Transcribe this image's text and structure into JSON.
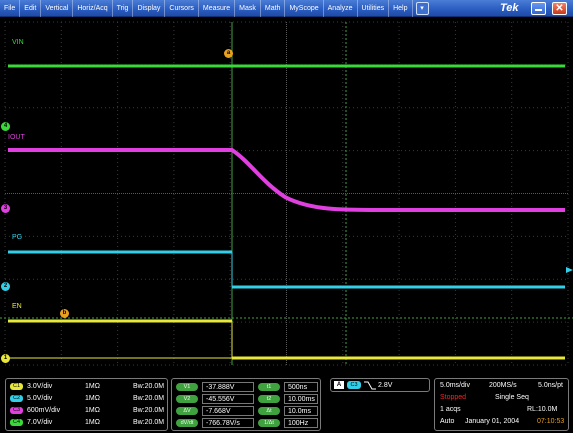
{
  "menu": {
    "items": [
      "File",
      "Edit",
      "Vertical",
      "Horiz/Acq",
      "Trig",
      "Display",
      "Cursors",
      "Measure",
      "Mask",
      "Math",
      "MyScope",
      "Analyze",
      "Utilities",
      "Help"
    ],
    "dropdown_icon": "down-arrow-icon",
    "brand": "Tek"
  },
  "traces": {
    "vin": "VIN",
    "iout": "IOUT",
    "pg": "PG",
    "en": "EN",
    "cursor_a": "a",
    "cursor_b": "b"
  },
  "channel_markers": {
    "ch4": "4",
    "ch3": "3",
    "ch2": "2",
    "ch1": "1"
  },
  "colors": {
    "ch1": "#e8e83a",
    "ch2": "#32d0e8",
    "ch3": "#e040e0",
    "ch4": "#3ad93a",
    "cursor": "#3fa23f"
  },
  "channels": [
    {
      "badge": "C1",
      "scale": "3.0V/div",
      "impedance": "1MΩ",
      "bw": "Bᴡ:20.0M"
    },
    {
      "badge": "C2",
      "scale": "5.0V/div",
      "impedance": "1MΩ",
      "bw": "Bᴡ:20.0M"
    },
    {
      "badge": "C3",
      "scale": "600mV/div",
      "impedance": "1MΩ",
      "bw": "Bᴡ:20.0M"
    },
    {
      "badge": "C4",
      "scale": "7.0V/div",
      "impedance": "1MΩ",
      "bw": "Bᴡ:20.0M"
    }
  ],
  "cursors": {
    "left": [
      {
        "badge": "V1",
        "value": "-37.888V"
      },
      {
        "badge": "V2",
        "value": "-45.556V"
      },
      {
        "badge": "ΔV",
        "value": "-7.668V"
      },
      {
        "badge": "dV/dt",
        "value": "-766.78V/s"
      }
    ],
    "right": [
      {
        "badge": "t1",
        "value": "500ns"
      },
      {
        "badge": "t2",
        "value": "10.00ms"
      },
      {
        "badge": "Δt",
        "value": "10.0ms"
      },
      {
        "badge": "1/Δt",
        "value": "100Hz"
      }
    ]
  },
  "trigger": {
    "mode": "A",
    "source": "C3",
    "slope": "falling-edge-icon",
    "level": "2.8V"
  },
  "acquisition": {
    "timebase": "5.0ms/div",
    "sample_rate": "200MS/s",
    "resolution": "5.0ns/pt",
    "state": "Stopped",
    "seq": "Single Seq",
    "acqs": "1 acqs",
    "record_length": "RL:10.0M",
    "mode": "Auto",
    "date": "January 01, 2004",
    "time": "07:10:53"
  }
}
